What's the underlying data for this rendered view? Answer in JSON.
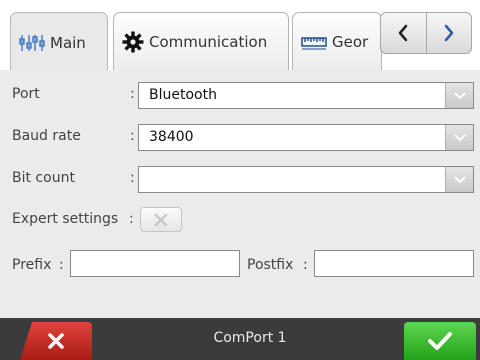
{
  "tabs": [
    {
      "label": "Main",
      "icon": "settings-split-icon"
    },
    {
      "label": "Communication",
      "icon": "gear-icon"
    },
    {
      "label": "Geor",
      "icon": "ruler-icon"
    }
  ],
  "nav": {
    "prev_icon": "chevron-left-icon",
    "next_icon": "chevron-right-icon"
  },
  "form": {
    "port": {
      "label": "Port",
      "colon": ":",
      "value": "Bluetooth"
    },
    "baud_rate": {
      "label": "Baud rate",
      "colon": ":",
      "value": "38400"
    },
    "bit_count": {
      "label": "Bit count",
      "colon": ":",
      "value": ""
    },
    "expert_settings": {
      "label": "Expert settings",
      "colon": ":",
      "checked": false
    },
    "prefix": {
      "label": "Prefix",
      "colon": ":",
      "value": ""
    },
    "postfix": {
      "label": "Postfix",
      "colon": ":",
      "value": ""
    }
  },
  "footer": {
    "title": "ComPort 1",
    "cancel_icon": "close-icon",
    "ok_icon": "check-icon"
  },
  "colors": {
    "cancel": "#c62b24",
    "ok": "#3bbd2f",
    "footer_bg": "#3b3b3b"
  }
}
